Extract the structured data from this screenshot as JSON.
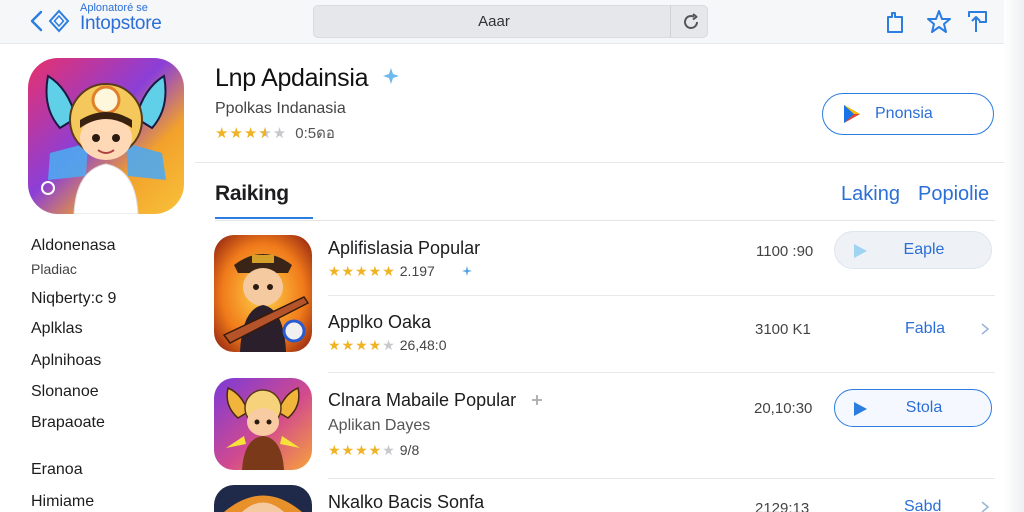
{
  "topbar": {
    "brand_small": "Aplonatoré se",
    "brand_name": "Intopstore",
    "search_text": "Aaar"
  },
  "app": {
    "title": "Lnp Apdainsia",
    "subtitle": "Ppolkas Indanasia",
    "rating_stars": 3.5,
    "rating_count": "0:5ดอ",
    "open_label": "Pnonsia"
  },
  "sidebar": {
    "items": [
      "Aldonenasa",
      "Pladiac",
      "Niqberty:c 9",
      "Aplklas",
      "Aplnihoas",
      "Slonanoe",
      "Brapaoate",
      "Eranoa",
      "Himiame"
    ]
  },
  "section": {
    "title": "Raiking",
    "filters": [
      "Laking",
      "Popiolie"
    ]
  },
  "rows": [
    {
      "name": "Aplifislasia Popular",
      "stars": 5,
      "count": "2.197",
      "size": "1100 :90",
      "action": "Eaple"
    },
    {
      "name": "Applko Oaka",
      "stars": 4,
      "count": "26,48:0",
      "size": "3100 K1",
      "action": "Fabla"
    },
    {
      "name": "Clnara Mabaile Popular",
      "subtitle": "Aplikan Dayes",
      "stars": 4,
      "count": "9/8",
      "size": "20,10:30",
      "action": "Stola"
    },
    {
      "name": "Nkalko Bacis Sonfa",
      "size": "2129:13",
      "action": "Sabd"
    }
  ],
  "colors": {
    "accent": "#2b7de0",
    "star": "#f0b323"
  }
}
